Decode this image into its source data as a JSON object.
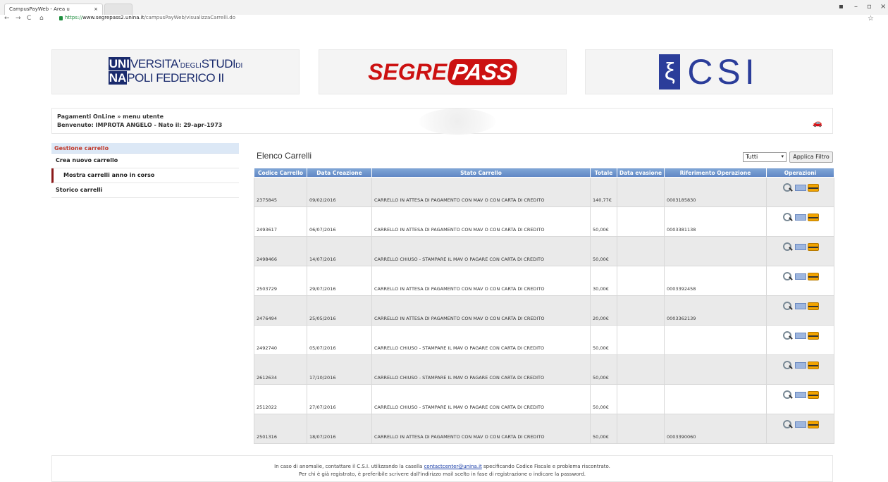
{
  "browser": {
    "tab_title": "CampusPayWeb - Area u",
    "tab_close": "×",
    "url_scheme": "https://",
    "url_host": "www.segrepass2.unina.it",
    "url_path": "/campusPayWeb/visualizzaCarrelli.do",
    "star": "☆"
  },
  "header": {
    "unina_line1_inv": "UNI",
    "unina_line1_text": "VERSITA'",
    "unina_line1_small": "DEGLI",
    "unina_line1_end": "STUDI",
    "unina_line1_di": "DI",
    "unina_line2_inv": "NA",
    "unina_line2_text": "POLI FEDERICO II",
    "segre_a": "SEGRE",
    "segre_b": "PASS",
    "csi_symbol": "ξ",
    "csi_text": "CSI"
  },
  "userbar": {
    "line1": "Pagamenti OnLine » menu utente",
    "line2": "Benvenuto:  IMPROTA ANGELO -  Nato il:  29-apr-1973",
    "car_icon": "🚗"
  },
  "sidebar": {
    "header": "Gestione carrello",
    "items": [
      {
        "label": "Crea nuovo carrello"
      },
      {
        "label": "Mostra carrelli anno in corso"
      },
      {
        "label": "Storico carrelli"
      }
    ]
  },
  "content": {
    "title": "Elenco Carrelli",
    "filter_value": "Tutti",
    "apply_label": "Applica Filtro"
  },
  "table": {
    "headers": [
      "Codice Carrello",
      "Data Creazione",
      "Stato Carrello",
      "Totale",
      "Data evasione",
      "Riferimento Operazione",
      "Operazioni"
    ],
    "rows": [
      {
        "codice": "2375845",
        "data": "09/02/2016",
        "stato": "CARRELLO IN ATTESA DI PAGAMENTO CON MAV O CON CARTA DI CREDITO",
        "totale": "140,77€",
        "evasione": "",
        "rif": "0003185830"
      },
      {
        "codice": "2493617",
        "data": "06/07/2016",
        "stato": "CARRELLO IN ATTESA DI PAGAMENTO CON MAV O CON CARTA DI CREDITO",
        "totale": "50,00€",
        "evasione": "",
        "rif": "0003381138"
      },
      {
        "codice": "2498466",
        "data": "14/07/2016",
        "stato": "CARRELLO CHIUSO - STAMPARE IL MAV O PAGARE CON CARTA DI CREDITO",
        "totale": "50,00€",
        "evasione": "",
        "rif": ""
      },
      {
        "codice": "2503729",
        "data": "29/07/2016",
        "stato": "CARRELLO IN ATTESA DI PAGAMENTO CON MAV O CON CARTA DI CREDITO",
        "totale": "30,00€",
        "evasione": "",
        "rif": "0003392458"
      },
      {
        "codice": "2476494",
        "data": "25/05/2016",
        "stato": "CARRELLO IN ATTESA DI PAGAMENTO CON MAV O CON CARTA DI CREDITO",
        "totale": "20,00€",
        "evasione": "",
        "rif": "0003362139"
      },
      {
        "codice": "2492740",
        "data": "05/07/2016",
        "stato": "CARRELLO CHIUSO - STAMPARE IL MAV O PAGARE CON CARTA DI CREDITO",
        "totale": "50,00€",
        "evasione": "",
        "rif": ""
      },
      {
        "codice": "2612634",
        "data": "17/10/2016",
        "stato": "CARRELLO CHIUSO - STAMPARE IL MAV O PAGARE CON CARTA DI CREDITO",
        "totale": "50,00€",
        "evasione": "",
        "rif": ""
      },
      {
        "codice": "2512022",
        "data": "27/07/2016",
        "stato": "CARRELLO CHIUSO - STAMPARE IL MAV O PAGARE CON CARTA DI CREDITO",
        "totale": "50,00€",
        "evasione": "",
        "rif": ""
      },
      {
        "codice": "2501316",
        "data": "18/07/2016",
        "stato": "CARRELLO IN ATTESA DI PAGAMENTO CON MAV O CON CARTA DI CREDITO",
        "totale": "50,00€",
        "evasione": "",
        "rif": "0003390060"
      }
    ]
  },
  "footer": {
    "line1_a": "In caso di anomalie, contattare il C.S.I. utilizzando la casella ",
    "line1_link": "contactcenter@unina.it",
    "line1_b": " specificando Codice Fiscale e problema riscontrato.",
    "line2": "Per chi è già registrato, è preferibile scrivere dall'indirizzo mail scelto in fase di registrazione o indicare la password."
  }
}
